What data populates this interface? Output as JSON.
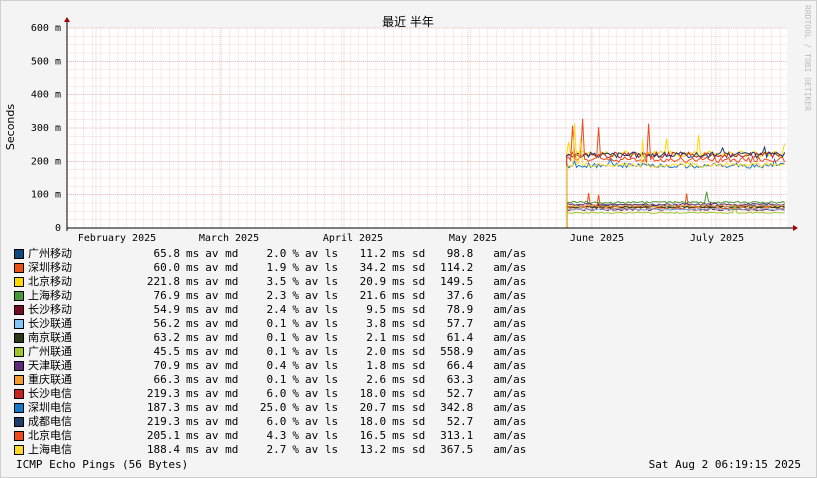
{
  "chart_data": {
    "type": "line",
    "title": "最近 半年",
    "ylabel": "Seconds",
    "watermark": "RRDTOOL / TOBI OETIKER",
    "y_ticks": [
      "0",
      "100 m",
      "200 m",
      "300 m",
      "400 m",
      "500 m",
      "600 m"
    ],
    "y_tick_values": [
      0,
      0.1,
      0.2,
      0.3,
      0.4,
      0.5,
      0.6
    ],
    "ylim": [
      0,
      0.6
    ],
    "x_ticks": [
      "February 2025",
      "March 2025",
      "April 2025",
      "May 2025",
      "June 2025",
      "July 2025"
    ],
    "grid": true,
    "data_start_fraction": 0.78,
    "series": [
      {
        "name": "广州移动",
        "color": "#0c4a7e",
        "level": 0.0658,
        "spike": 0.098
      },
      {
        "name": "深圳移动",
        "color": "#ea4f14",
        "level": 0.06,
        "spike": 0.114
      },
      {
        "name": "北京移动",
        "color": "#ffd700",
        "level": 0.2218,
        "spike": 0.28
      },
      {
        "name": "上海移动",
        "color": "#489a3a",
        "level": 0.0769,
        "spike": 0.12
      },
      {
        "name": "长沙移动",
        "color": "#730d22",
        "level": 0.0549,
        "spike": 0.0789
      },
      {
        "name": "长沙联通",
        "color": "#84c4f7",
        "level": 0.0562,
        "spike": 0.0577
      },
      {
        "name": "南京联通",
        "color": "#2c3a12",
        "level": 0.0632,
        "spike": 0.0614
      },
      {
        "name": "广州联通",
        "color": "#a1c42c",
        "level": 0.0455,
        "spike": 0.07
      },
      {
        "name": "天津联通",
        "color": "#5e2b7f",
        "level": 0.0709,
        "spike": 0.0664
      },
      {
        "name": "重庆联通",
        "color": "#f49b2e",
        "level": 0.0663,
        "spike": 0.0633
      },
      {
        "name": "长沙电信",
        "color": "#c8221f",
        "level": 0.2193,
        "spike": 0.24
      },
      {
        "name": "深圳电信",
        "color": "#1778c4",
        "level": 0.1873,
        "spike": 0.21
      },
      {
        "name": "成都电信",
        "color": "#1d3c6e",
        "level": 0.2193,
        "spike": 0.26
      },
      {
        "name": "北京电信",
        "color": "#ef4a1e",
        "level": 0.2051,
        "spike": 0.38
      },
      {
        "name": "上海电信",
        "color": "#ffd928",
        "level": 0.1884,
        "spike": 0.32
      }
    ]
  },
  "legend": {
    "rows": [
      {
        "name": "广州移动",
        "color": "#0c4a7e",
        "avg": "65.8",
        "loss": "2.0",
        "sd": "11.2",
        "amas": "98.8"
      },
      {
        "name": "深圳移动",
        "color": "#ea4f14",
        "avg": "60.0",
        "loss": "1.9",
        "sd": "34.2",
        "amas": "114.2"
      },
      {
        "name": "北京移动",
        "color": "#ffd700",
        "avg": "221.8",
        "loss": "3.5",
        "sd": "20.9",
        "amas": "149.5"
      },
      {
        "name": "上海移动",
        "color": "#489a3a",
        "avg": "76.9",
        "loss": "2.3",
        "sd": "21.6",
        "amas": "37.6"
      },
      {
        "name": "长沙移动",
        "color": "#730d22",
        "avg": "54.9",
        "loss": "2.4",
        "sd": "9.5",
        "amas": "78.9"
      },
      {
        "name": "长沙联通",
        "color": "#84c4f7",
        "avg": "56.2",
        "loss": "0.1",
        "sd": "3.8",
        "amas": "57.7"
      },
      {
        "name": "南京联通",
        "color": "#2c3a12",
        "avg": "63.2",
        "loss": "0.1",
        "sd": "2.1",
        "amas": "61.4"
      },
      {
        "name": "广州联通",
        "color": "#a1c42c",
        "avg": "45.5",
        "loss": "0.1",
        "sd": "2.0",
        "amas": "558.9"
      },
      {
        "name": "天津联通",
        "color": "#5e2b7f",
        "avg": "70.9",
        "loss": "0.4",
        "sd": "1.8",
        "amas": "66.4"
      },
      {
        "name": "重庆联通",
        "color": "#f49b2e",
        "avg": "66.3",
        "loss": "0.1",
        "sd": "2.6",
        "amas": "63.3"
      },
      {
        "name": "长沙电信",
        "color": "#c8221f",
        "avg": "219.3",
        "loss": "6.0",
        "sd": "18.0",
        "amas": "52.7"
      },
      {
        "name": "深圳电信",
        "color": "#1778c4",
        "avg": "187.3",
        "loss": "25.0",
        "sd": "20.7",
        "amas": "342.8"
      },
      {
        "name": "成都电信",
        "color": "#1d3c6e",
        "avg": "219.3",
        "loss": "6.0",
        "sd": "18.0",
        "amas": "52.7"
      },
      {
        "name": "北京电信",
        "color": "#ef4a1e",
        "avg": "205.1",
        "loss": "4.3",
        "sd": "16.5",
        "amas": "313.1"
      },
      {
        "name": "上海电信",
        "color": "#ffd928",
        "avg": "188.4",
        "loss": "2.7",
        "sd": "13.2",
        "amas": "367.5"
      }
    ],
    "unit_ms": "ms",
    "av_md": "av md",
    "pct": "%",
    "av_ls": "av ls",
    "ms_sd": "ms sd",
    "amas_label": "am/as"
  },
  "footer": {
    "left": "ICMP Echo Pings (56 Bytes)",
    "right": "Sat Aug  2 06:19:15 2025"
  }
}
